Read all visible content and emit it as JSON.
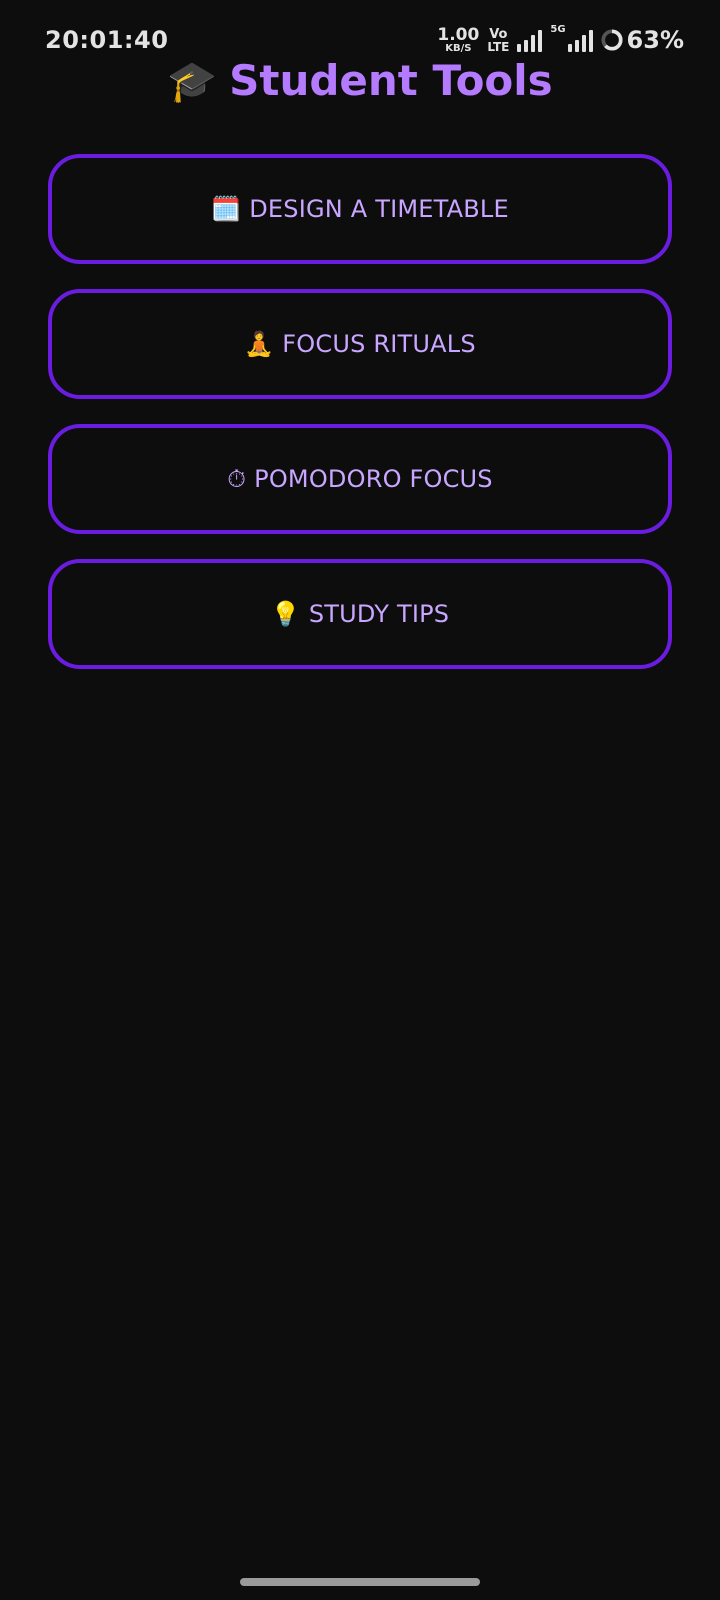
{
  "status_bar": {
    "time": "20:01:40",
    "net_speed_value": "1.00",
    "net_speed_unit": "KB/S",
    "volte_top": "Vo",
    "volte_bottom": "LTE",
    "network_gen": "5G",
    "battery": "63%"
  },
  "header": {
    "icon": "🎓",
    "icon_name": "graduation-cap-icon",
    "title": "Student Tools"
  },
  "tools": [
    {
      "icon": "🗓️",
      "icon_name": "calendar-icon",
      "label": "DESIGN A TIMETABLE"
    },
    {
      "icon": "🧘",
      "icon_name": "meditation-icon",
      "label": "FOCUS RITUALS"
    },
    {
      "icon": "⏱",
      "icon_name": "stopwatch-icon",
      "label": "POMODORO FOCUS"
    },
    {
      "icon": "💡",
      "icon_name": "lightbulb-icon",
      "label": "STUDY TIPS"
    }
  ],
  "colors": {
    "background": "#0d0d0d",
    "accent_border": "#6a1de0",
    "title_text": "#b57bff",
    "button_text": "#c9a6ff"
  }
}
